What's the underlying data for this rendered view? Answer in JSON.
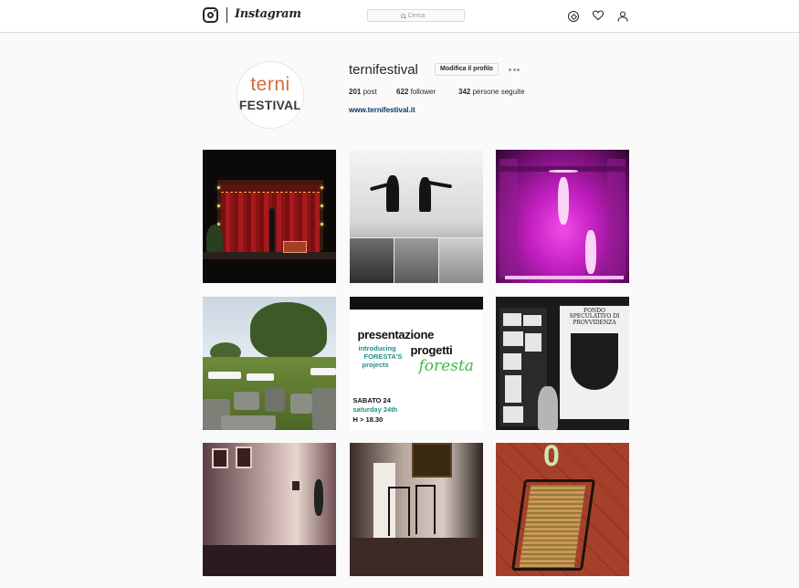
{
  "nav": {
    "brand": "Instagram",
    "search_placeholder": "Cerca",
    "icons": [
      "instagram-glyph-icon",
      "compass-icon",
      "heart-icon",
      "user-icon"
    ]
  },
  "profile": {
    "avatar": {
      "line1": "terni",
      "line2": "FESTIVAL"
    },
    "username": "ternifestival",
    "edit_button": "Modifica il profilo",
    "stats": {
      "posts_count": "201",
      "posts_label": "post",
      "followers_count": "622",
      "followers_label": "follower",
      "following_count": "342",
      "following_label": "persone seguite"
    },
    "website": "www.ternifestival.it"
  },
  "posts": {
    "poster": {
      "title_line1": "presentazione",
      "subtitle_line1": "introducing",
      "title_word2": "progetti",
      "subtitle_line2": "FORESTA'S",
      "subtitle_line3": "projects",
      "script_word": "foresta",
      "date_it": "SABATO 24",
      "date_en": "saturday 24th",
      "time": "H > 18.30"
    },
    "sign_text": "FONDO SPECULATIVO DI PROVVIDENZA",
    "chair_number": "0"
  },
  "colors": {
    "accent_link": "#003569",
    "border": "#dbdbdb",
    "background": "#fafafa",
    "avatar_orange": "#d8683a"
  }
}
